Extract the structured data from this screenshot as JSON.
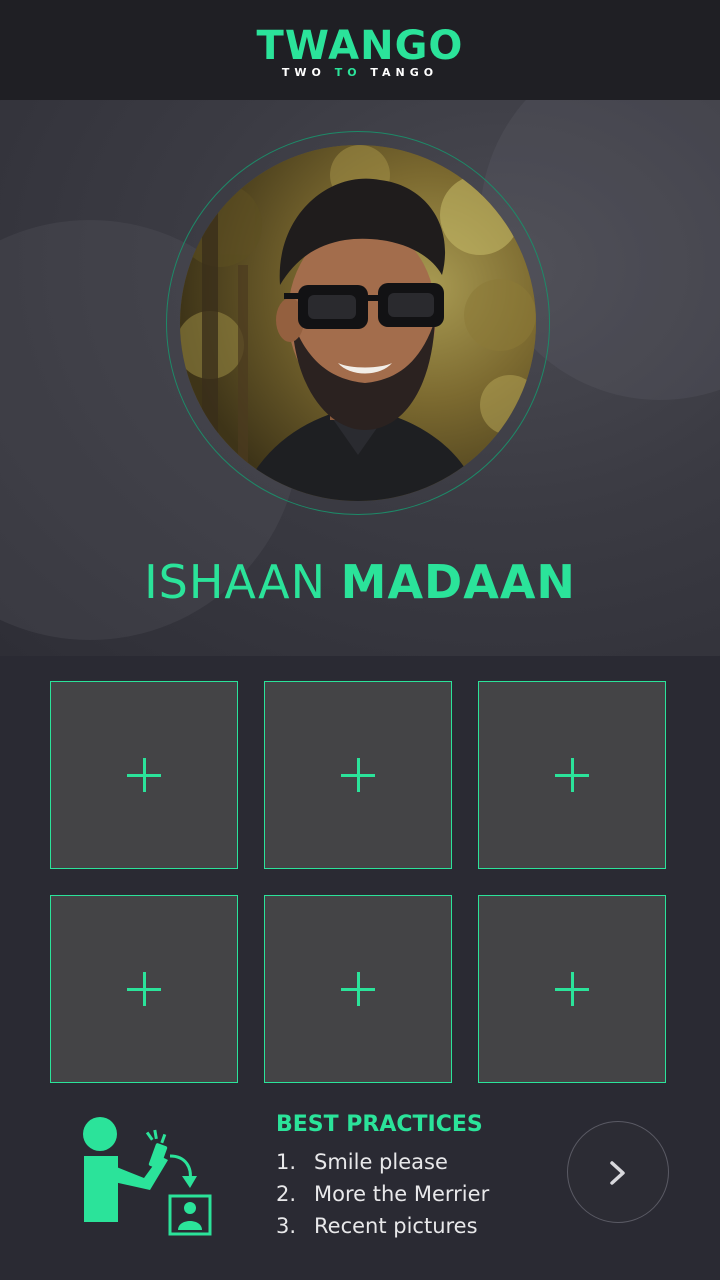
{
  "header": {
    "logo_title": "TWANGO",
    "logo_sub_left": "TWO",
    "logo_sub_mid": "TO",
    "logo_sub_right": "TANGO"
  },
  "profile": {
    "first_name": "ISHAAN",
    "last_name": "MADAAN"
  },
  "photo_slots": [
    {
      "icon": "plus-icon"
    },
    {
      "icon": "plus-icon"
    },
    {
      "icon": "plus-icon"
    },
    {
      "icon": "plus-icon"
    },
    {
      "icon": "plus-icon"
    },
    {
      "icon": "plus-icon"
    }
  ],
  "best_practices": {
    "title": "BEST PRACTICES",
    "items": [
      {
        "num": "1.",
        "text": "Smile please"
      },
      {
        "num": "2.",
        "text": "More the Merrier"
      },
      {
        "num": "3.",
        "text": "Recent pictures"
      }
    ]
  },
  "next_button": {
    "icon": "chevron-right-icon"
  },
  "colors": {
    "accent": "#2be39a",
    "header_bg": "#1f1f24",
    "page_bg": "#2a2a33",
    "slot_bg": "#444446"
  }
}
